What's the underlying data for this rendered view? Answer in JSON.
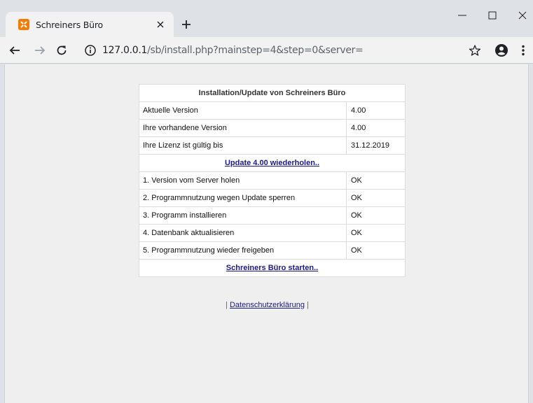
{
  "browser": {
    "tab_title": "Schreiners Büro",
    "url_host": "127.0.0.1",
    "url_path": "/sb/install.php?mainstep=4&step=0&server=",
    "icons": [
      "favicon-icon",
      "close-icon",
      "plus-icon",
      "minimize-icon",
      "maximize-icon",
      "window-close-icon",
      "back-arrow-icon",
      "forward-arrow-icon",
      "reload-icon",
      "info-icon",
      "star-icon",
      "account-icon",
      "more-menu-icon"
    ],
    "favicon_color": "#f57c00"
  },
  "install": {
    "title": "Installation/Update von Schreiners Büro",
    "rows": [
      {
        "label": "Aktuelle Version",
        "value": "4.00"
      },
      {
        "label": "Ihre vorhandene Version",
        "value": "4.00"
      },
      {
        "label": "Ihre Lizenz ist gültig bis",
        "value": "31.12.2019"
      }
    ],
    "update_link": "Update 4.00 wiederholen..",
    "steps": [
      {
        "label": "1. Version vom Server holen",
        "status": "OK"
      },
      {
        "label": "2. Programmnutzung wegen Update sperren",
        "status": "OK"
      },
      {
        "label": "3. Programm installieren",
        "status": "OK"
      },
      {
        "label": "4. Datenbank aktualisieren",
        "status": "OK"
      },
      {
        "label": "5. Programmnutzung wieder freigeben",
        "status": "OK"
      }
    ],
    "start_link": "Schreiners Büro starten.."
  },
  "footer": {
    "left_sep": "|",
    "privacy_link": "Datenschutzerklärung",
    "right_sep": "|"
  }
}
